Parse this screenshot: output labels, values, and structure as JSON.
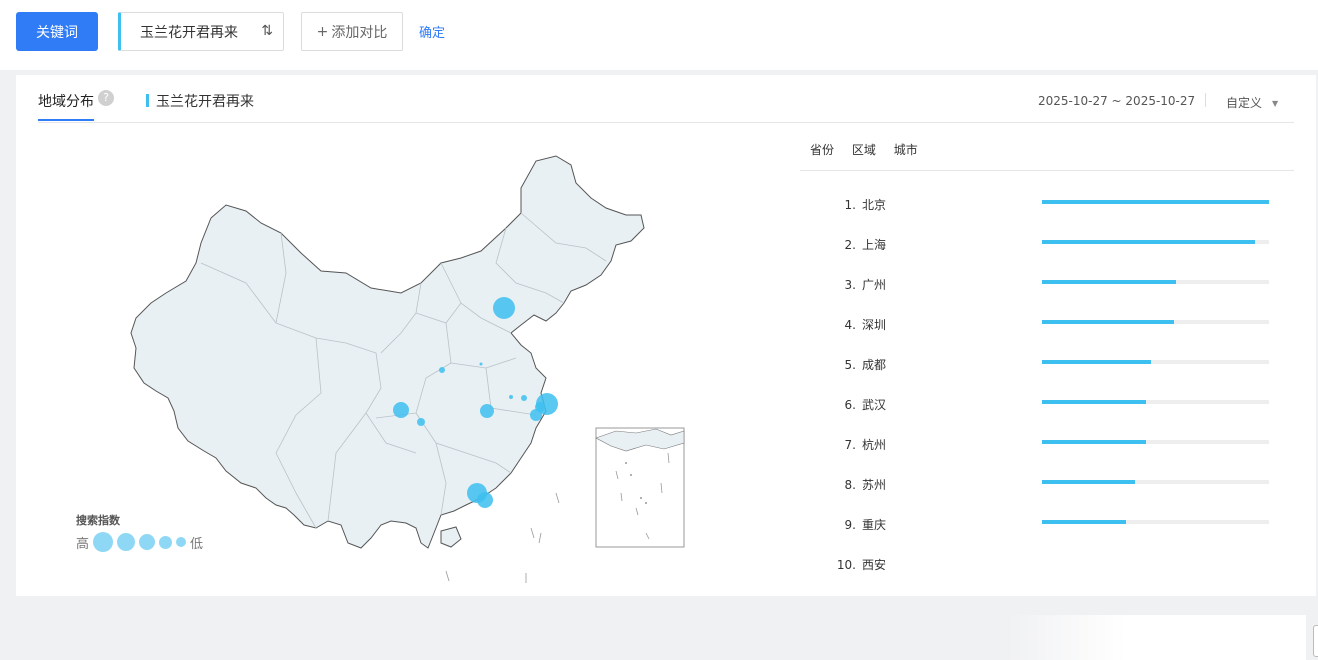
{
  "toolbar": {
    "keyword_button": "关键词",
    "keyword_chip": "玉兰花开君再来",
    "add_compare": "添加对比",
    "confirm": "确定"
  },
  "panel": {
    "tab_label": "地域分布",
    "help_glyph": "?",
    "legend_keyword": "玉兰花开君再来",
    "date_range": "2025-10-27 ~ 2025-10-27",
    "custom_select": "自定义"
  },
  "map_legend": {
    "title": "搜索指数",
    "high": "高",
    "low": "低"
  },
  "ranking": {
    "tabs": [
      "省份",
      "区域",
      "城市"
    ],
    "items": [
      {
        "rank": "1.",
        "city": "北京",
        "value": 1.0
      },
      {
        "rank": "2.",
        "city": "上海",
        "value": 0.94
      },
      {
        "rank": "3.",
        "city": "广州",
        "value": 0.59
      },
      {
        "rank": "4.",
        "city": "深圳",
        "value": 0.58
      },
      {
        "rank": "5.",
        "city": "成都",
        "value": 0.48
      },
      {
        "rank": "6.",
        "city": "武汉",
        "value": 0.46
      },
      {
        "rank": "7.",
        "city": "杭州",
        "value": 0.46
      },
      {
        "rank": "8.",
        "city": "苏州",
        "value": 0.41
      },
      {
        "rank": "9.",
        "city": "重庆",
        "value": 0.37
      },
      {
        "rank": "10.",
        "city": "西安",
        "value": null
      }
    ]
  },
  "colors": {
    "accent": "#2f7cf6",
    "bar": "#3dbff0",
    "bubble": "#3dbff0",
    "map_fill": "#e8f0f4"
  }
}
